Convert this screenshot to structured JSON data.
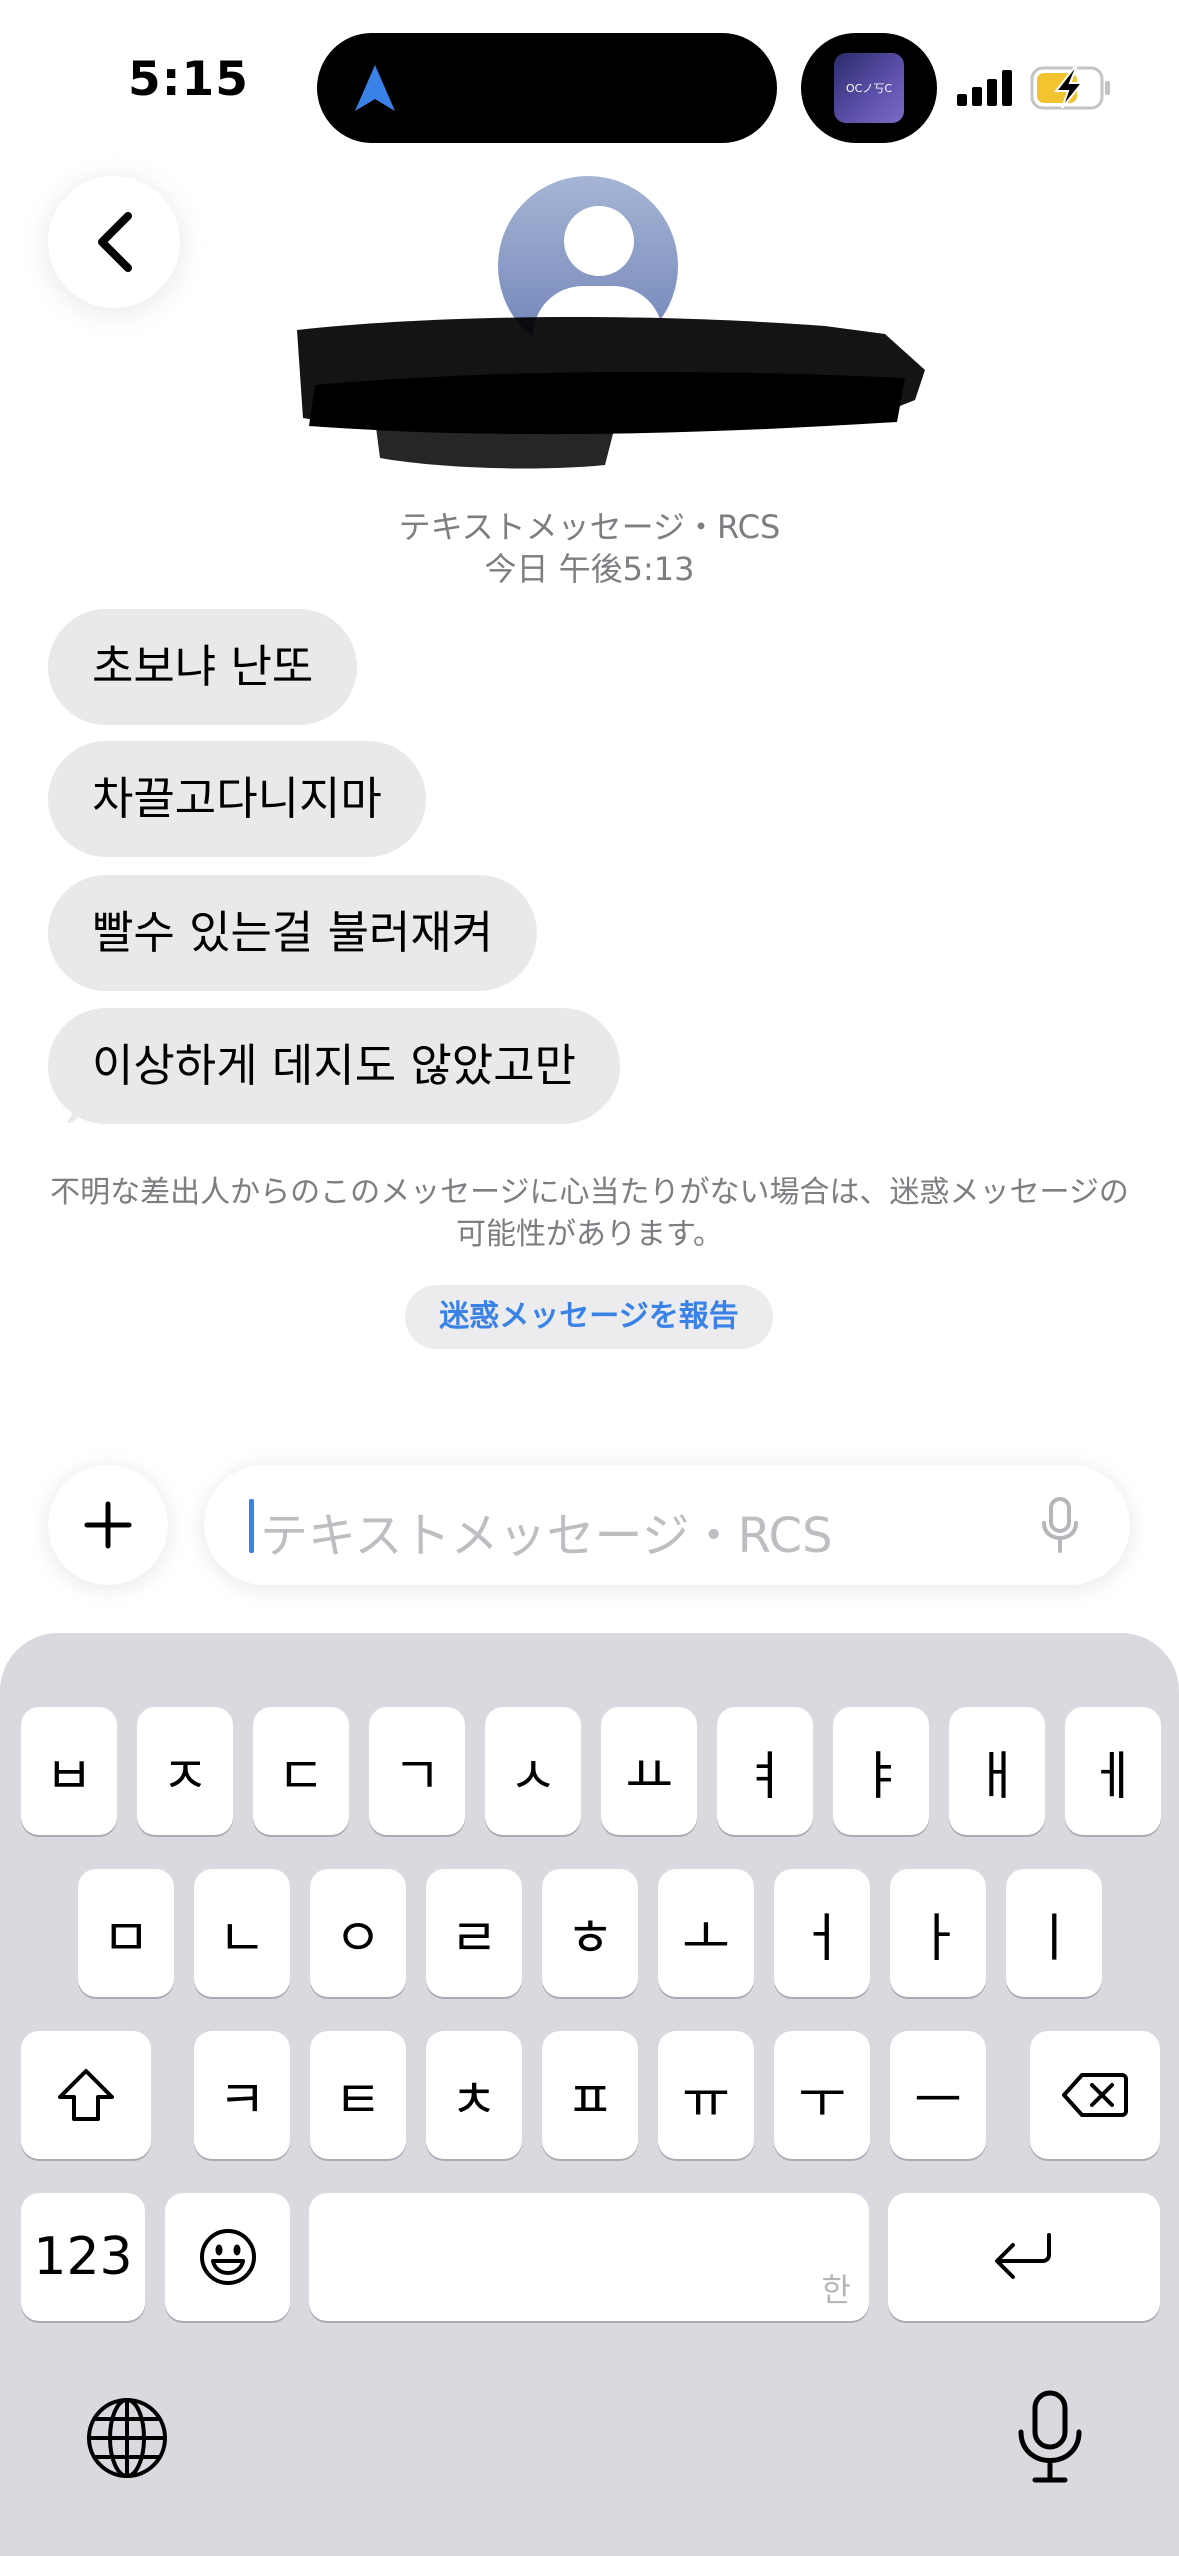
{
  "status_bar": {
    "time": "5:15",
    "now_playing_art_text": "OCノ丂C"
  },
  "header": {
    "service_label": "テキストメッセージ・RCS",
    "timestamp": "今日 午後5:13"
  },
  "messages": [
    {
      "text": "초보냐  난또"
    },
    {
      "text": "차끌고다니지마"
    },
    {
      "text": "빨수 있는걸 불러재켜"
    },
    {
      "text": "이상하게 데지도 않았고만"
    }
  ],
  "spam_notice": "不明な差出人からのこのメッセージに心当たりがない場合は、迷惑メッセージの可能性があります。",
  "report_button_label": "迷惑メッセージを報告",
  "composer": {
    "placeholder": "テキストメッセージ・RCS"
  },
  "keyboard": {
    "row1": [
      "ㅂ",
      "ㅈ",
      "ㄷ",
      "ㄱ",
      "ㅅ",
      "ㅛ",
      "ㅕ",
      "ㅑ",
      "ㅐ",
      "ㅔ"
    ],
    "row2": [
      "ㅁ",
      "ㄴ",
      "ㅇ",
      "ㄹ",
      "ㅎ",
      "ㅗ",
      "ㅓ",
      "ㅏ",
      "ㅣ"
    ],
    "row3": [
      "ㅋ",
      "ㅌ",
      "ㅊ",
      "ㅍ",
      "ㅠ",
      "ㅜ",
      "ㅡ"
    ],
    "numbers_key": "123",
    "space_hint": "한"
  },
  "colors": {
    "accent": "#3b82e8",
    "bubble_gray": "#e9e9eb",
    "keyboard_bg": "#d8dadf",
    "battery_charging": "#f4c430"
  },
  "icons": {
    "back": "chevron-left-icon",
    "plus": "plus-icon",
    "composer_mic": "microphone-icon",
    "shift": "shift-icon",
    "delete": "delete-backward-icon",
    "emoji": "emoji-icon",
    "return": "return-icon",
    "globe": "globe-icon",
    "dictation": "microphone-icon"
  }
}
